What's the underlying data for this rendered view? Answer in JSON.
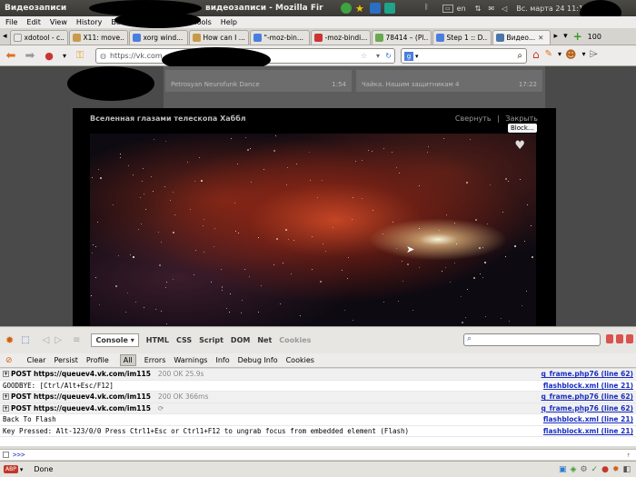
{
  "window": {
    "title_left": "Видеозаписи",
    "title_right": "видеозаписи - Mozilla Fir",
    "clock": "Вс. марта 24 11:19",
    "keyboard": "en"
  },
  "menu": {
    "items": [
      "File",
      "Edit",
      "View",
      "History",
      "Bookmarks",
      "Tools",
      "Help"
    ]
  },
  "tabs": [
    {
      "label": "xdotool - c...",
      "color": "#e8e8e8"
    },
    {
      "label": "X11: move...",
      "color": "#c89a4a"
    },
    {
      "label": "xorg wind...",
      "color": "#4a7de0"
    },
    {
      "label": "How can I ...",
      "color": "#c89a4a"
    },
    {
      "label": "\"-moz-bin...",
      "color": "#4a7de0"
    },
    {
      "label": "-moz-bindi...",
      "color": "#cc3333"
    },
    {
      "label": "78414 – (Pl...",
      "color": "#6aa84f"
    },
    {
      "label": "Step 1 :: D...",
      "color": "#4a7de0"
    },
    {
      "label": "Видео...",
      "color": "#4a76a8"
    }
  ],
  "tab_count": "100",
  "url": {
    "value": "https://vk.com"
  },
  "content": {
    "item1": {
      "title": "Petrosyan Neurofunk Dance",
      "duration": "1:54"
    },
    "item2": {
      "title": "Чайка. Нашим защитникам 4",
      "duration": "17:22"
    },
    "viewer_title": "Вселенная глазами телескопа Хаббл",
    "minimize": "Свернуть",
    "sep": "|",
    "close": "Закрыть",
    "tooltip": "Block..."
  },
  "firebug": {
    "tabs": [
      "Console ▾",
      "HTML",
      "CSS",
      "Script",
      "DOM",
      "Net",
      "Cookies"
    ],
    "filters": [
      "Clear",
      "Persist",
      "Profile",
      "All",
      "Errors",
      "Warnings",
      "Info",
      "Debug Info",
      "Cookies"
    ],
    "log": [
      {
        "type": "post",
        "text": "POST https://queuev4.vk.com/im115",
        "status": "200 OK 25.9s",
        "src": "q_frame.php76 (line 62)"
      },
      {
        "type": "text",
        "text": "GOODBYE: [Ctrl/Alt+Esc/F12]",
        "status": "",
        "src": "flashblock.xml (line 21)"
      },
      {
        "type": "post",
        "text": "POST https://queuev4.vk.com/im115",
        "status": "200 OK 366ms",
        "src": "q_frame.php76 (line 62)"
      },
      {
        "type": "post",
        "text": "POST https://queuev4.vk.com/im115",
        "status": "⟳",
        "src": "q_frame.php76 (line 62)"
      },
      {
        "type": "text",
        "text": "Back To Flash",
        "status": "",
        "src": "flashblock.xml (line 21)"
      },
      {
        "type": "text",
        "text": "Key Pressed: Alt-123/0/0 Press Ctrl1+Esc or Ctrl1+F12 to ungrab focus from embedded element (Flash)",
        "status": "",
        "src": "flashblock.xml (line 21)"
      }
    ],
    "prompt": ">>>"
  },
  "status": {
    "text": "Done",
    "abp": "ABP"
  }
}
